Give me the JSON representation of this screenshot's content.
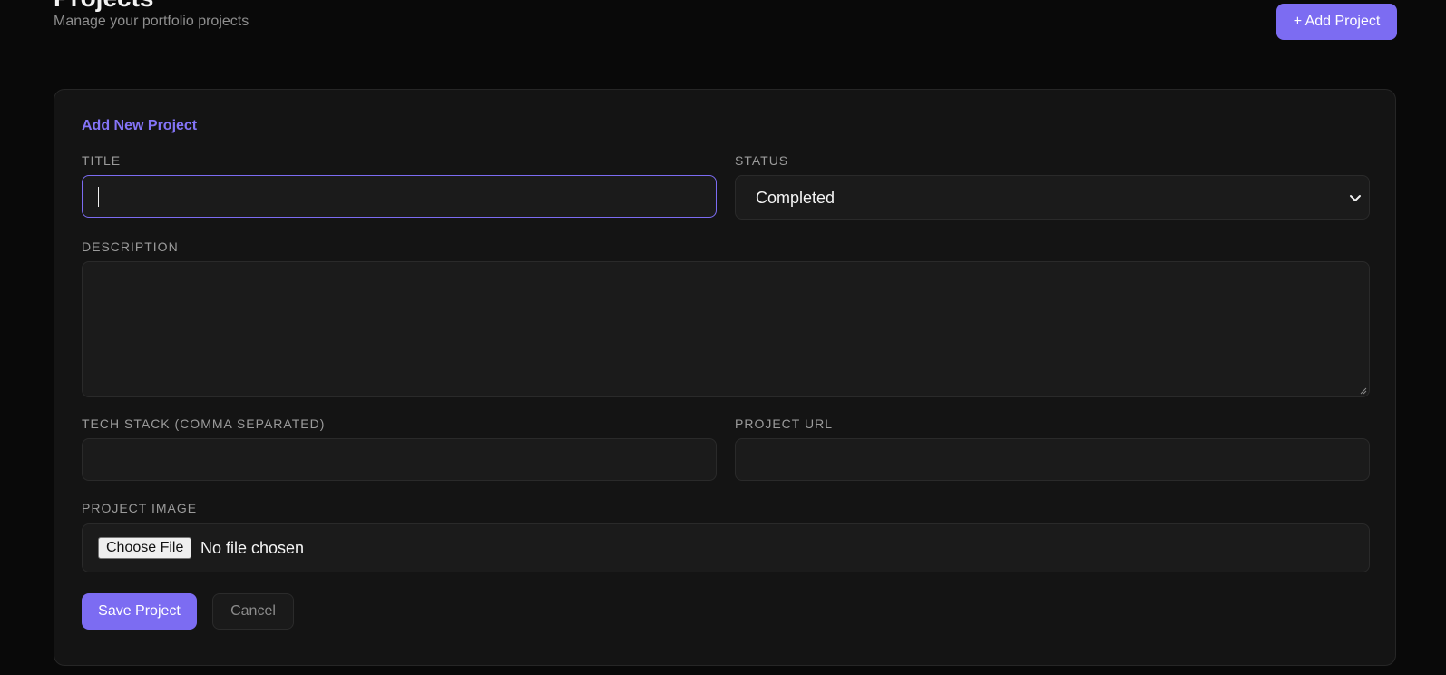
{
  "header": {
    "title": "Projects",
    "subtitle": "Manage your portfolio projects",
    "add_button_label": "+ Add Project"
  },
  "form": {
    "heading": "Add New Project",
    "title_field": {
      "label": "TITLE",
      "value": ""
    },
    "status_field": {
      "label": "STATUS",
      "selected": "Completed"
    },
    "description_field": {
      "label": "DESCRIPTION",
      "value": ""
    },
    "tech_stack_field": {
      "label": "TECH STACK (COMMA SEPARATED)",
      "value": ""
    },
    "project_url_field": {
      "label": "PROJECT URL",
      "value": ""
    },
    "image_field": {
      "label": "PROJECT IMAGE",
      "button_label": "Choose File",
      "status_text": "No file chosen"
    },
    "save_label": "Save Project",
    "cancel_label": "Cancel"
  },
  "colors": {
    "background": "#090909",
    "card": "#141414",
    "accent": "#7c6cf2",
    "heading_accent": "#8474f7",
    "label": "#9b9b9b"
  },
  "icons": {
    "status_dropdown": "chevron-down-icon",
    "description_resize": "resize-grip-icon"
  }
}
